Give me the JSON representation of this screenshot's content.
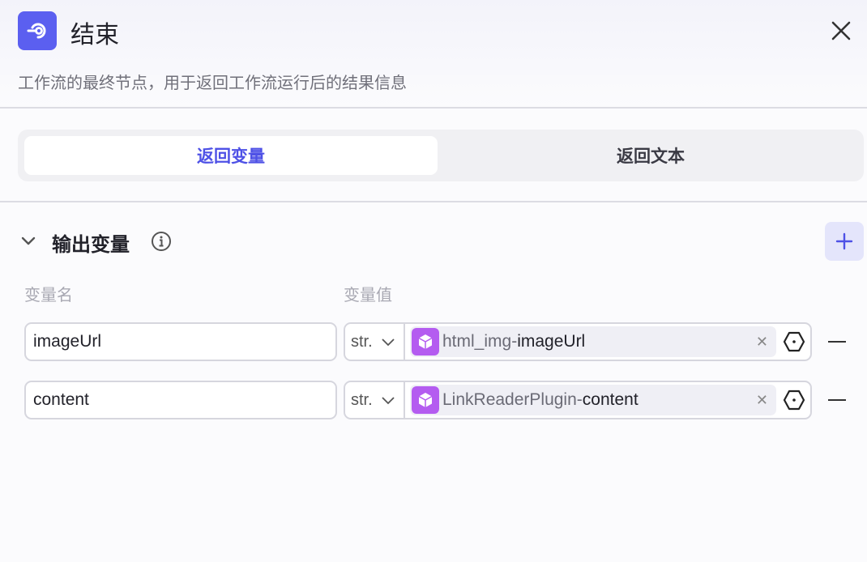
{
  "header": {
    "title": "结束",
    "description": "工作流的最终节点，用于返回工作流运行后的结果信息"
  },
  "tabs": [
    {
      "label": "返回变量",
      "active": true
    },
    {
      "label": "返回文本",
      "active": false
    }
  ],
  "section": {
    "title": "输出变量"
  },
  "columns": {
    "name": "变量名",
    "value": "变量值"
  },
  "rows": [
    {
      "name": "imageUrl",
      "type": "str.",
      "node": "html_img",
      "separator": " - ",
      "field": "imageUrl"
    },
    {
      "name": "content",
      "type": "str.",
      "node": "LinkReaderPlugin",
      "separator": " - ",
      "field": "content"
    }
  ],
  "colors": {
    "accent": "#4e51e6",
    "logo": "#5b5ff0",
    "node_icon": "#b45cf0"
  }
}
